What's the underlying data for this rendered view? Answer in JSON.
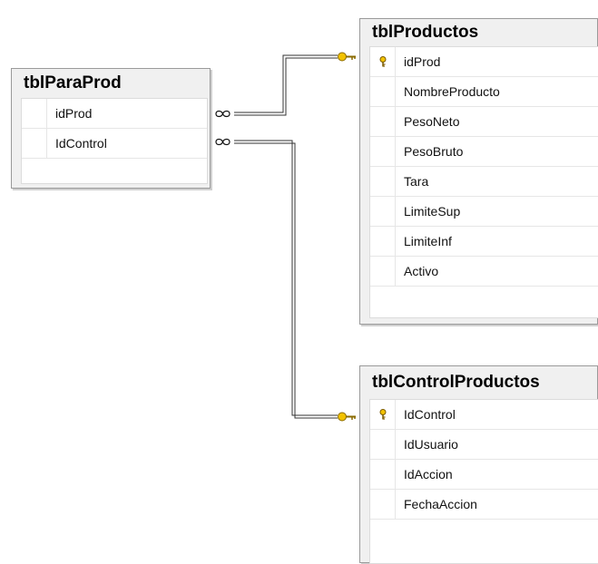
{
  "tables": [
    {
      "id": "tblParaProd",
      "title": "tblParaProd",
      "columns": [
        {
          "name": "idProd",
          "primary_key": false
        },
        {
          "name": "IdControl",
          "primary_key": false
        }
      ]
    },
    {
      "id": "tblProductos",
      "title": "tblProductos",
      "columns": [
        {
          "name": "idProd",
          "primary_key": true
        },
        {
          "name": "NombreProducto",
          "primary_key": false
        },
        {
          "name": "PesoNeto",
          "primary_key": false
        },
        {
          "name": "PesoBruto",
          "primary_key": false
        },
        {
          "name": "Tara",
          "primary_key": false
        },
        {
          "name": "LimiteSup",
          "primary_key": false
        },
        {
          "name": "LimiteInf",
          "primary_key": false
        },
        {
          "name": "Activo",
          "primary_key": false
        }
      ]
    },
    {
      "id": "tblControlProductos",
      "title": "tblControlProductos",
      "columns": [
        {
          "name": "IdControl",
          "primary_key": true
        },
        {
          "name": "IdUsuario",
          "primary_key": false
        },
        {
          "name": "IdAccion",
          "primary_key": false
        },
        {
          "name": "FechaAccion",
          "primary_key": false
        }
      ]
    }
  ],
  "relationships": [
    {
      "from_table": "tblParaProd",
      "from_column": "idProd",
      "from_end": "many",
      "to_table": "tblProductos",
      "to_column": "idProd",
      "to_end": "key"
    },
    {
      "from_table": "tblParaProd",
      "from_column": "IdControl",
      "from_end": "many",
      "to_table": "tblControlProductos",
      "to_column": "IdControl",
      "to_end": "key"
    }
  ],
  "icons": {
    "primary_key": "key-icon",
    "many_end": "infinity-icon",
    "one_end": "key-icon"
  },
  "colors": {
    "background": "#ffffff",
    "table_frame": "#f0f0f0",
    "key": "#f2c200",
    "connector": "#333333"
  }
}
